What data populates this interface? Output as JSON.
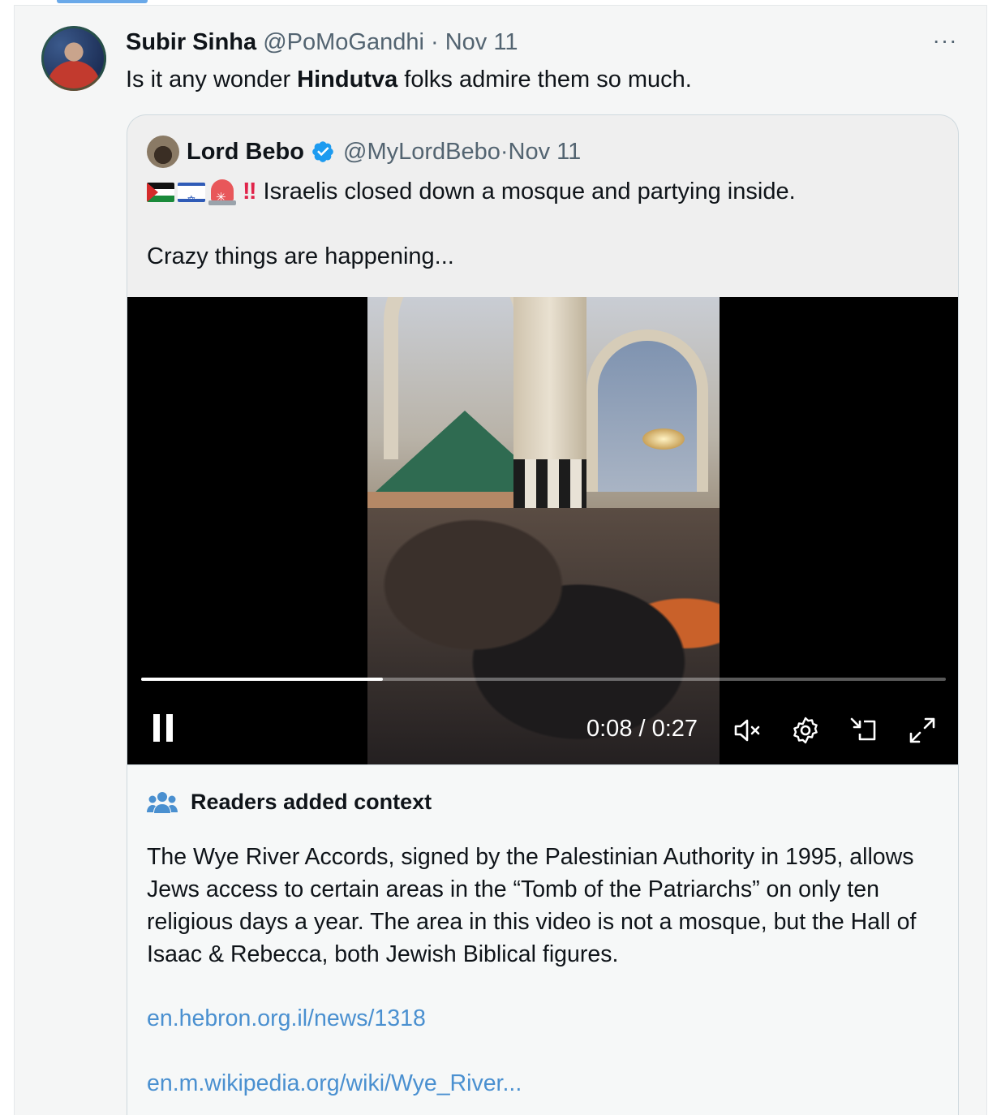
{
  "post": {
    "author_name": "Subir Sinha",
    "author_handle": "@PoMoGandhi",
    "separator": "·",
    "date": "Nov 11",
    "text_before": "Is it any wonder ",
    "text_bold": "Hindutva",
    "text_after": " folks admire them so much.",
    "more_label": "···"
  },
  "quoted": {
    "author_name": "Lord Bebo",
    "author_handle": "@MyLordBebo",
    "separator": "·",
    "date": "Nov 11",
    "emoji_prefix": [
      "flag-palestine",
      "flag-israel",
      "rotating-light",
      "double-exclamation"
    ],
    "bangs": "‼",
    "line1": "Israelis closed down a mosque and partying inside.",
    "line2": "Crazy things are happening..."
  },
  "video": {
    "time_current": "0:08",
    "time_total": "0:27",
    "time_label": "0:08 / 0:27",
    "progress": 0.3,
    "state": "playing",
    "muted": true,
    "icons": [
      "pause-icon",
      "muted-speaker-icon",
      "settings-gear-icon",
      "picture-in-picture-icon",
      "fullscreen-icon"
    ]
  },
  "context": {
    "header": "Readers added context",
    "body": "The Wye River Accords, signed by the Palestinian Authority in 1995, allows Jews access to certain areas in the “Tomb of the Patriarchs” on only ten religious days a year. The area in this video is not a mosque, but the Hall of Isaac & Rebecca, both Jewish Biblical figures.",
    "links": [
      "en.hebron.org.il/news/1318",
      "en.m.wikipedia.org/wiki/Wye_River..."
    ]
  },
  "colors": {
    "link": "#4a90d0",
    "verified": "#1d9bf0",
    "meta_text": "#536471",
    "card_bg": "#f5f6f6"
  }
}
